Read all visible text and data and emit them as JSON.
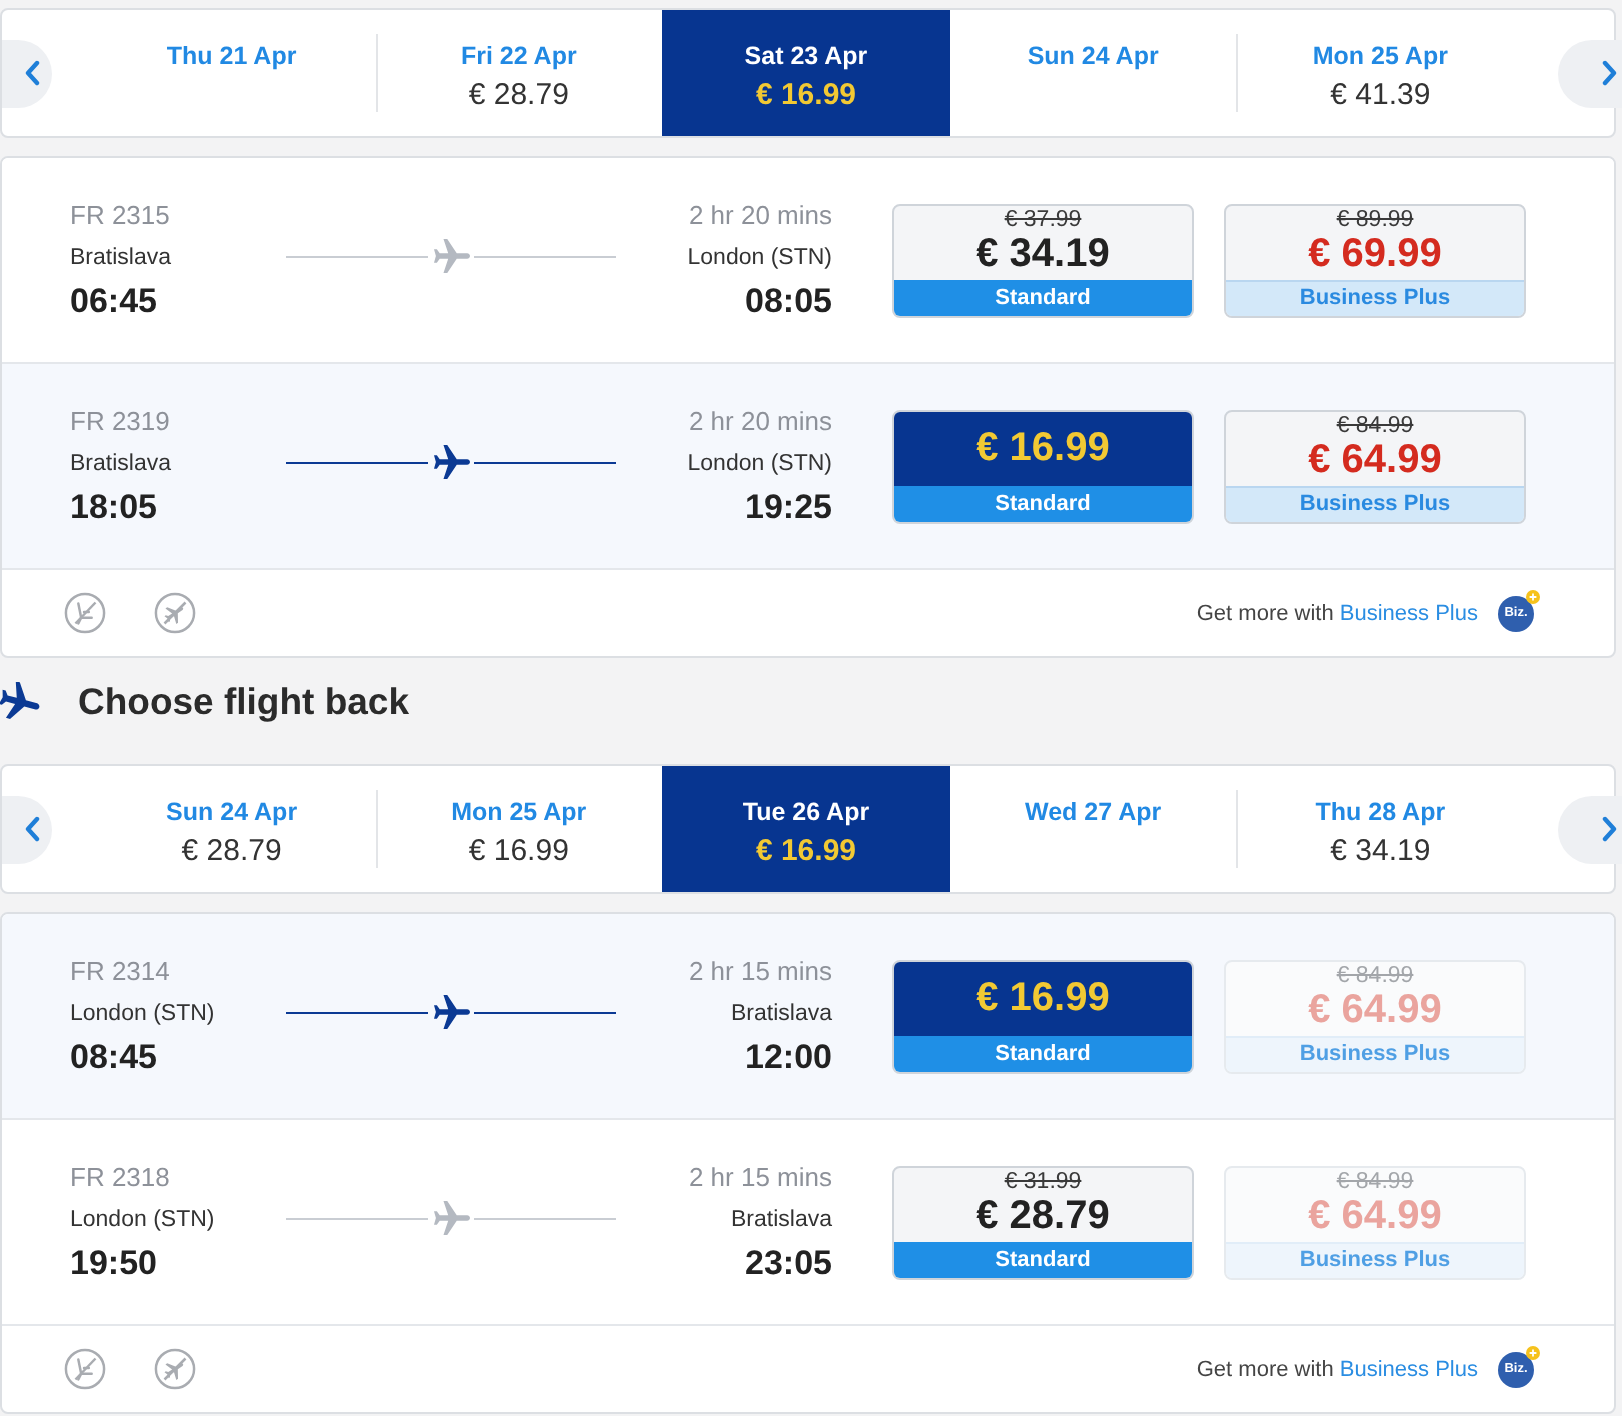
{
  "outbound": {
    "dates": [
      {
        "date": "Thu 21 Apr",
        "selected": false
      },
      {
        "date": "Fri 22 Apr",
        "price": "€ 28.79",
        "selected": false
      },
      {
        "date": "Sat 23 Apr",
        "price": "€ 16.99",
        "selected": true
      },
      {
        "date": "Sun 24 Apr",
        "selected": false
      },
      {
        "date": "Mon 25 Apr",
        "price": "€ 41.39",
        "selected": false
      }
    ],
    "flights": [
      {
        "flight_number": "FR 2315",
        "origin": "Bratislava",
        "departure": "06:45",
        "duration": "2 hr 20 mins",
        "destination": "London (STN)",
        "arrival": "08:05",
        "selected": false,
        "fares": [
          {
            "kind": "standard",
            "old_price": "€ 37.99",
            "price": "€ 34.19",
            "label": "Standard",
            "selected": false,
            "disabled": false
          },
          {
            "kind": "business",
            "old_price": "€ 89.99",
            "price": "€ 69.99",
            "label": "Business Plus",
            "selected": false,
            "disabled": false
          }
        ]
      },
      {
        "flight_number": "FR 2319",
        "origin": "Bratislava",
        "departure": "18:05",
        "duration": "2 hr 20 mins",
        "destination": "London (STN)",
        "arrival": "19:25",
        "selected": true,
        "fares": [
          {
            "kind": "standard",
            "price": "€ 16.99",
            "label": "Standard",
            "selected": true,
            "disabled": false
          },
          {
            "kind": "business",
            "old_price": "€ 84.99",
            "price": "€ 64.99",
            "label": "Business Plus",
            "selected": false,
            "disabled": false
          }
        ]
      }
    ],
    "footer": {
      "text": "Get more with",
      "link": "Business Plus",
      "badge": "Biz."
    }
  },
  "return_heading": "Choose flight back",
  "inbound": {
    "dates": [
      {
        "date": "Sun 24 Apr",
        "price": "€ 28.79",
        "selected": false
      },
      {
        "date": "Mon 25 Apr",
        "price": "€ 16.99",
        "selected": false
      },
      {
        "date": "Tue 26 Apr",
        "price": "€ 16.99",
        "selected": true
      },
      {
        "date": "Wed 27 Apr",
        "selected": false
      },
      {
        "date": "Thu 28 Apr",
        "price": "€ 34.19",
        "selected": false
      }
    ],
    "flights": [
      {
        "flight_number": "FR 2314",
        "origin": "London (STN)",
        "departure": "08:45",
        "duration": "2 hr 15 mins",
        "destination": "Bratislava",
        "arrival": "12:00",
        "selected": true,
        "fares": [
          {
            "kind": "standard",
            "price": "€ 16.99",
            "label": "Standard",
            "selected": true,
            "disabled": false
          },
          {
            "kind": "business",
            "old_price": "€ 84.99",
            "price": "€ 64.99",
            "label": "Business Plus",
            "selected": false,
            "disabled": true
          }
        ]
      },
      {
        "flight_number": "FR 2318",
        "origin": "London (STN)",
        "departure": "19:50",
        "duration": "2 hr 15 mins",
        "destination": "Bratislava",
        "arrival": "23:05",
        "selected": false,
        "fares": [
          {
            "kind": "standard",
            "old_price": "€ 31.99",
            "price": "€ 28.79",
            "label": "Standard",
            "selected": false,
            "disabled": false
          },
          {
            "kind": "business",
            "old_price": "€ 84.99",
            "price": "€ 64.99",
            "label": "Business Plus",
            "selected": false,
            "disabled": true
          }
        ]
      }
    ],
    "footer": {
      "text": "Get more with",
      "link": "Business Plus",
      "badge": "Biz."
    }
  }
}
